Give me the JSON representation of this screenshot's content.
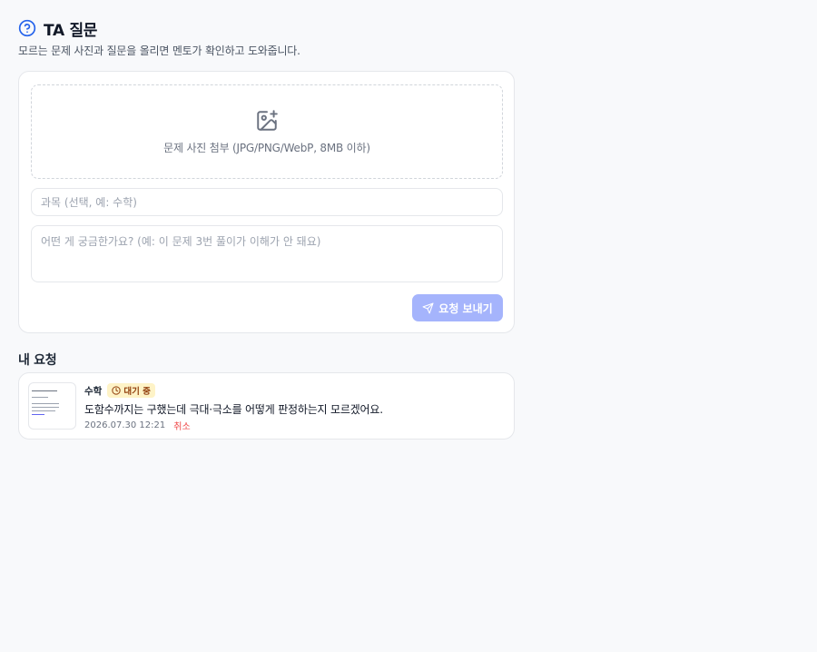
{
  "header": {
    "title": "TA 질문",
    "subtitle": "모르는 문제 사진과 질문을 올리면 멘토가 확인하고 도와줍니다."
  },
  "form": {
    "dropzone_label": "문제 사진 첨부 (JPG/PNG/WebP, 8MB 이하)",
    "subject_placeholder": "과목 (선택, 예: 수학)",
    "subject_value": "",
    "question_placeholder": "어떤 게 궁금한가요? (예: 이 문제 3번 풀이가 이해가 안 돼요)",
    "question_value": "",
    "send_label": "요청 보내기"
  },
  "my_requests": {
    "section_title": "내 요청",
    "items": [
      {
        "subject": "수학",
        "status": "대기 중",
        "question": "도함수까지는 구했는데 극대·극소를 어떻게 판정하는지 모르겠어요.",
        "timestamp": "2026.07.30 12:21",
        "cancel_label": "취소"
      }
    ]
  },
  "colors": {
    "accent": "#2563eb",
    "send_button_disabled": "#a5b4fc",
    "status_pending_bg": "#fef3c7",
    "status_pending_text": "#92400e",
    "cancel": "#ef4444"
  },
  "icons": {
    "title": "question-circle-icon",
    "dropzone": "image-plus-icon",
    "send": "send-icon",
    "status": "clock-icon"
  }
}
